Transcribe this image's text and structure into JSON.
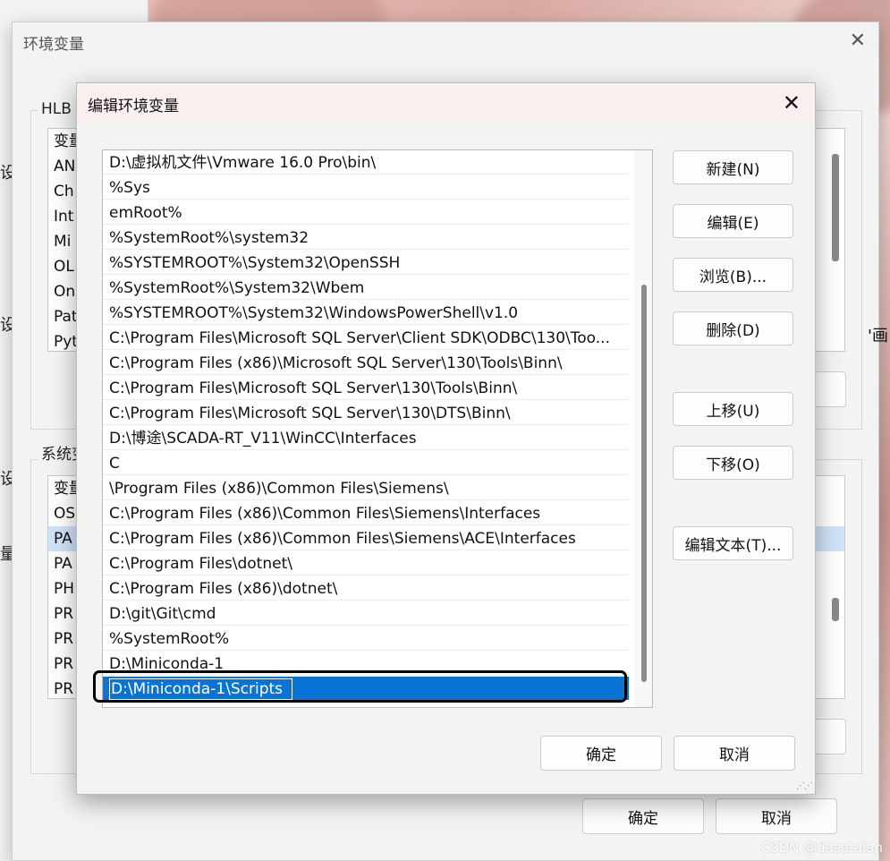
{
  "left_window": {
    "fragments": [
      "设",
      "设",
      "设",
      "量"
    ]
  },
  "env_window": {
    "title": "环境变量",
    "user_group_label": "HLB 的",
    "user_vars": [
      "变量",
      "AN",
      "Ch",
      "Int",
      "Mi",
      "OL",
      "On",
      "Pat",
      "Pyt"
    ],
    "system_group_label": "系统变",
    "system_vars": [
      "变量",
      "OS",
      "PA",
      "PA",
      "PH",
      "PR",
      "PR",
      "PR",
      "PR"
    ],
    "right_fragment": "'画",
    "ok": "确定",
    "cancel": "取消"
  },
  "edit_dialog": {
    "title": "编辑环境变量",
    "paths": [
      "D:\\虚拟机文件\\Vmware 16.0 Pro\\bin\\",
      "%Sys",
      "emRoot%",
      "%SystemRoot%\\system32",
      "%SYSTEMROOT%\\System32\\OpenSSH",
      "%SystemRoot%\\System32\\Wbem",
      "%SYSTEMROOT%\\System32\\WindowsPowerShell\\v1.0",
      "C:\\Program Files\\Microsoft SQL Server\\Client SDK\\ODBC\\130\\Too...",
      "C:\\Program Files (x86)\\Microsoft SQL Server\\130\\Tools\\Binn\\",
      "C:\\Program Files\\Microsoft SQL Server\\130\\Tools\\Binn\\",
      "C:\\Program Files\\Microsoft SQL Server\\130\\DTS\\Binn\\",
      "D:\\博途\\SCADA-RT_V11\\WinCC\\Interfaces",
      "C",
      "\\Program Files (x86)\\Common Files\\Siemens\\",
      "C:\\Program Files (x86)\\Common Files\\Siemens\\Interfaces",
      "C:\\Program Files (x86)\\Common Files\\Siemens\\ACE\\Interfaces",
      "C:\\Program Files\\dotnet\\",
      "C:\\Program Files (x86)\\dotnet\\",
      "D:\\git\\Git\\cmd",
      "%SystemRoot%",
      "D:\\Miniconda-1"
    ],
    "selected_path": "D:\\Miniconda-1\\Scripts",
    "buttons": {
      "new": "新建(N)",
      "edit": "编辑(E)",
      "browse": "浏览(B)...",
      "delete": "删除(D)",
      "move_up": "上移(U)",
      "move_down": "下移(O)",
      "edit_text": "编辑文本(T)..."
    },
    "ok": "确定",
    "cancel": "取消"
  },
  "watermark": "CSDN @dasatalan"
}
